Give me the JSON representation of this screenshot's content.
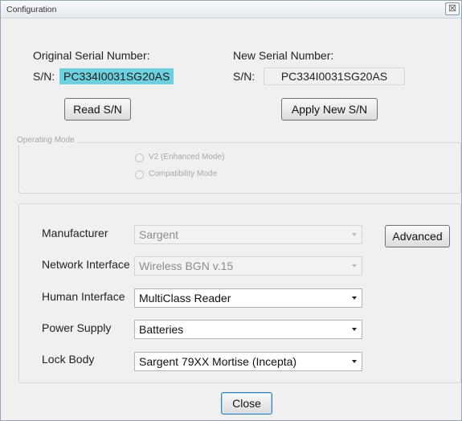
{
  "window": {
    "title": "Configuration",
    "close_glyph": "☒"
  },
  "original": {
    "label": "Original Serial Number:",
    "sn_prefix": "S/N:",
    "sn_value": "PC334I0031SG20AS",
    "read_button": "Read S/N"
  },
  "new": {
    "label": "New Serial Number:",
    "sn_prefix": "S/N:",
    "sn_value": "PC334I0031SG20AS",
    "apply_button": "Apply New S/N"
  },
  "operating_mode": {
    "title": "Operating Mode",
    "options": [
      {
        "label": "V2  (Enhanced Mode)",
        "selected": false,
        "enabled": false
      },
      {
        "label": "Compatibility Mode",
        "selected": false,
        "enabled": false
      }
    ]
  },
  "settings": {
    "manufacturer": {
      "label": "Manufacturer",
      "value": "Sargent",
      "enabled": false
    },
    "network_interface": {
      "label": "Network Interface",
      "value": "Wireless BGN v.15",
      "enabled": false
    },
    "human_interface": {
      "label": "Human Interface",
      "value": "MultiClass Reader",
      "enabled": true
    },
    "power_supply": {
      "label": "Power Supply",
      "value": "Batteries",
      "enabled": true
    },
    "lock_body": {
      "label": "Lock Body",
      "value": "Sargent 79XX Mortise (Incepta)",
      "enabled": true
    },
    "advanced_button": "Advanced"
  },
  "footer": {
    "close_button": "Close"
  },
  "colors": {
    "highlight": "#6ed0de",
    "window_bg": "#f0f0f0"
  }
}
